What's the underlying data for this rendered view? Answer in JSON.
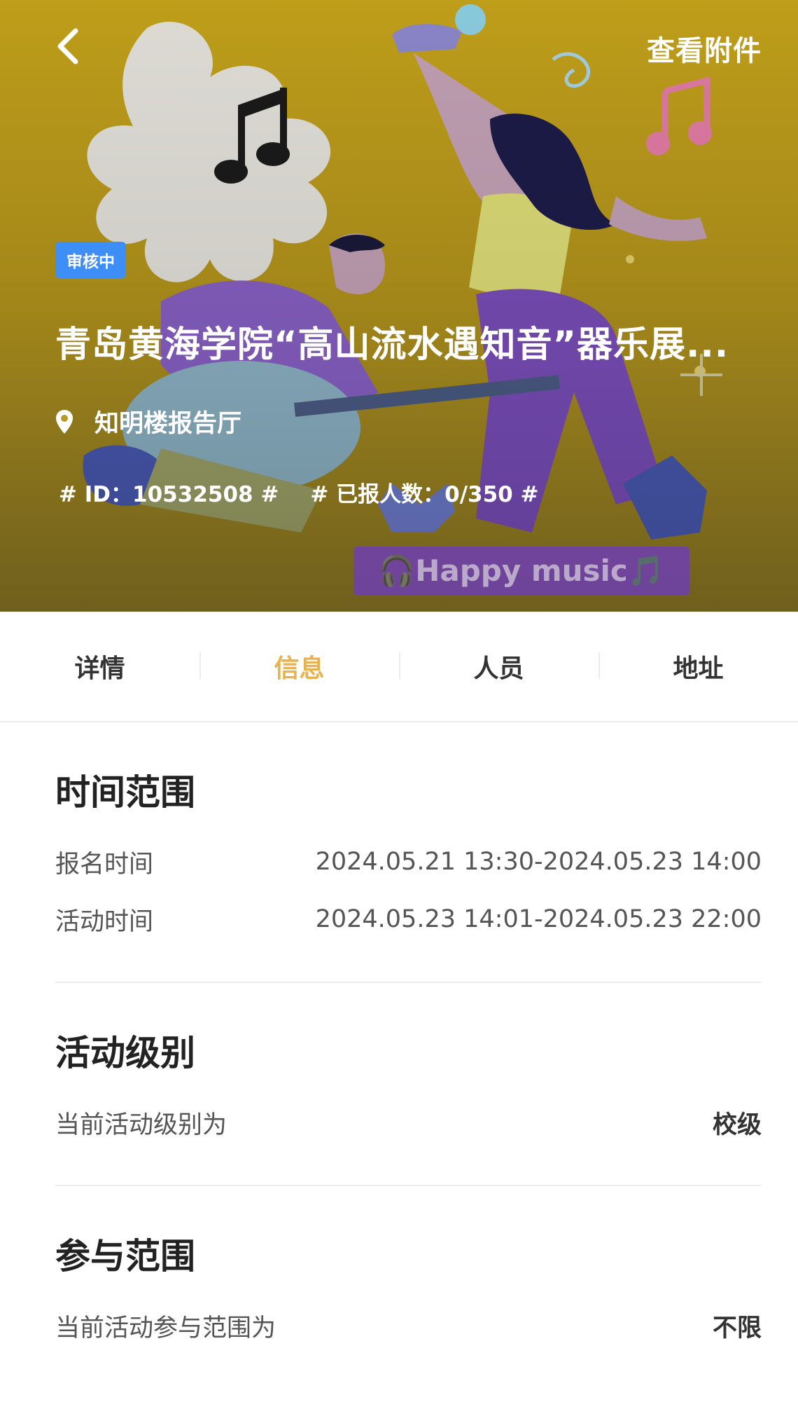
{
  "header": {
    "attachment_label": "查看附件",
    "status_badge": "审核中",
    "title": "青岛黄海学院“高山流水遇知音”器乐展...",
    "location": "知明楼报告厅",
    "id_tag": "# ID：10532508 #",
    "signup_tag": "# 已报人数：0/350 #",
    "banner_text": "🎧Happy music🎵"
  },
  "tabs": [
    {
      "label": "详情"
    },
    {
      "label": "信息"
    },
    {
      "label": "人员"
    },
    {
      "label": "地址"
    }
  ],
  "active_tab": "信息",
  "sections": {
    "time_range": {
      "title": "时间范围",
      "signup_label": "报名时间",
      "signup_value": "2024.05.21 13:30-2024.05.23 14:00",
      "activity_label": "活动时间",
      "activity_value": "2024.05.23 14:01-2024.05.23 22:00"
    },
    "level": {
      "title": "活动级别",
      "label": "当前活动级别为",
      "value": "校级"
    },
    "scope": {
      "title": "参与范围",
      "label": "当前活动参与范围为",
      "value": "不限"
    }
  },
  "colors": {
    "accent": "#e8b24e",
    "badge": "#3d8ef7",
    "hero_bg": "#c9a61b"
  }
}
